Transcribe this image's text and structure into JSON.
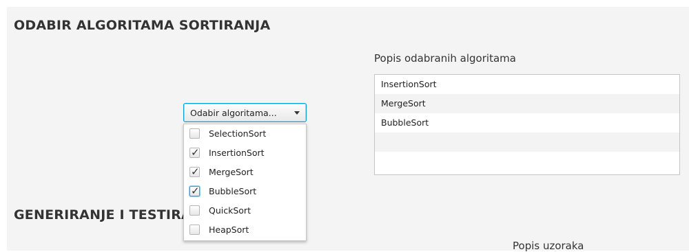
{
  "sections": {
    "selection_title": "ODABIR ALGORITAMA SORTIRANJA",
    "generation_title": "GENERIRANJE I TESTIRANJE"
  },
  "selected_list": {
    "label": "Popis odabranih algoritama",
    "items": [
      "InsertionSort",
      "MergeSort",
      "BubbleSort",
      "",
      ""
    ]
  },
  "combo": {
    "prompt": "Odabir algoritama..."
  },
  "dropdown": {
    "options": [
      {
        "label": "SelectionSort",
        "checked": false
      },
      {
        "label": "InsertionSort",
        "checked": true
      },
      {
        "label": "MergeSort",
        "checked": true
      },
      {
        "label": "BubbleSort",
        "checked": true
      },
      {
        "label": "QuickSort",
        "checked": false
      },
      {
        "label": "HeapSort",
        "checked": false
      }
    ]
  },
  "samples": {
    "label": "Popis uzoraka"
  }
}
